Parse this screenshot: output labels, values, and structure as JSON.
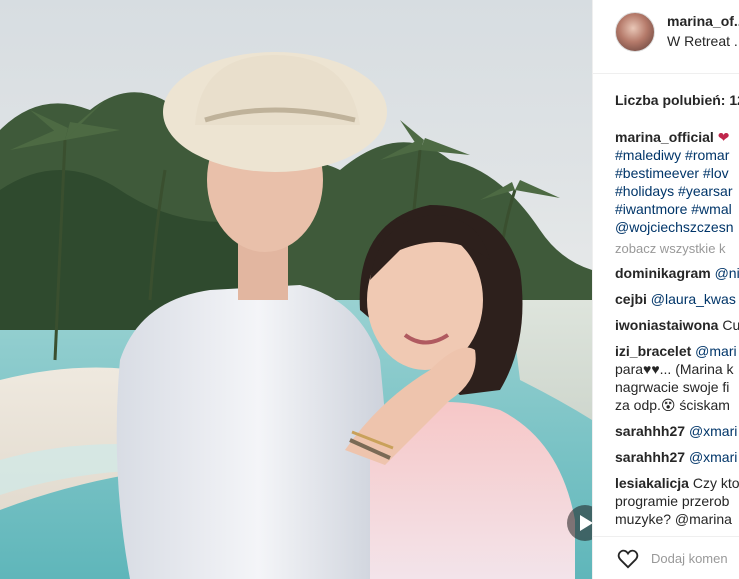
{
  "post": {
    "username": "marina_of...",
    "location": "W Retreat ...",
    "likes_label": "Liczba polubień: 12"
  },
  "caption": {
    "author": "marina_official",
    "heart": "❤",
    "lines": [
      "#malediwy #romar",
      "#bestimeever #lov",
      "#holidays #yearsar",
      "#iwantmore #wmal",
      "@wojciechszczesn"
    ]
  },
  "view_all_label": "zobacz wszystkie k",
  "comments": [
    {
      "user": "dominikagram",
      "lines": [
        "@ni"
      ]
    },
    {
      "user": "cejbi",
      "lines": [
        "@laura_kwas"
      ]
    },
    {
      "user": "iwoniastaiwona",
      "lines": [
        "Cu"
      ]
    },
    {
      "user": "izi_bracelet",
      "lines": [
        "@mari",
        "para♥♥... (Marina k",
        "nagrwacie swoje fi",
        "za odp.😵 ściskam"
      ]
    },
    {
      "user": "sarahhh27",
      "lines": [
        "@xmari"
      ]
    },
    {
      "user": "sarahhh27",
      "lines": [
        "@xmari"
      ]
    },
    {
      "user": "lesiakalicja",
      "lines": [
        "Czy kto",
        "programie przerob",
        "muzyke? @marina"
      ]
    }
  ],
  "add_comment_placeholder": "Dodaj komen",
  "icons": {
    "like": "heart-outline-icon",
    "video": "video-play-icon"
  },
  "colors": {
    "hashtag": "#003569",
    "border": "#efefef",
    "muted": "#999999"
  }
}
